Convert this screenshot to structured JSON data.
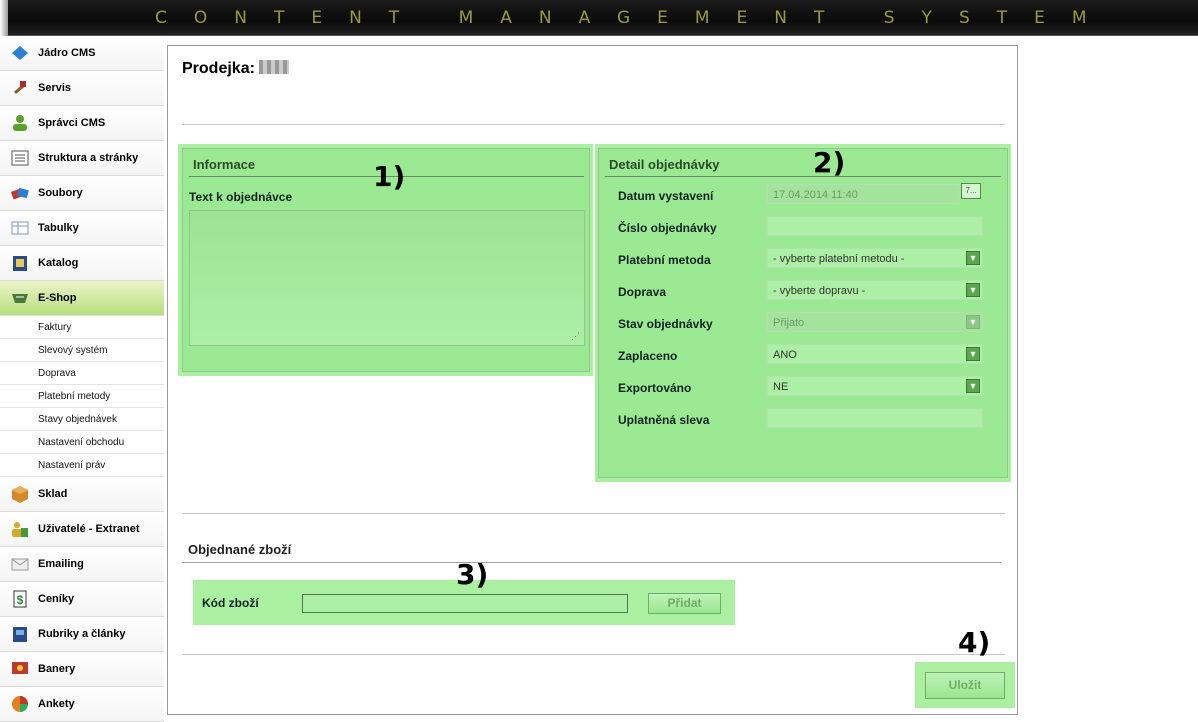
{
  "header": {
    "title": "CONTENT MANAGEMENT SYSTEM"
  },
  "sidebar": {
    "items_top": [
      {
        "label": "Jádro CMS",
        "icon": "diamond-icon",
        "color": "#2b7fd4"
      },
      {
        "label": "Servis",
        "icon": "hammer-icon",
        "color": "#b02a2a"
      },
      {
        "label": "Správci CMS",
        "icon": "user-icon",
        "color": "#5aa02c"
      },
      {
        "label": "Struktura a stránky",
        "icon": "list-icon",
        "color": "#555555"
      },
      {
        "label": "Soubory",
        "icon": "files-icon",
        "color": "#c0392b"
      },
      {
        "label": "Tabulky",
        "icon": "table-icon",
        "color": "#7a9acb"
      },
      {
        "label": "Katalog",
        "icon": "book-icon",
        "color": "#2a4a8a"
      },
      {
        "label": "E-Shop",
        "icon": "cart-icon",
        "color": "#4a7a3a"
      }
    ],
    "sub_items": [
      "Faktury",
      "Slevový systém",
      "Doprava",
      "Platební metody",
      "Stavy objednávek",
      "Nastavení obchodu",
      "Nastavení práv"
    ],
    "items_bottom": [
      {
        "label": "Sklad",
        "icon": "box-icon",
        "color": "#d48a2a"
      },
      {
        "label": "Uživatelé - Extranet",
        "icon": "users-icon",
        "color": "#d4a82a"
      },
      {
        "label": "Emailing",
        "icon": "envelope-icon",
        "color": "#999999"
      },
      {
        "label": "Ceníky",
        "icon": "dollar-icon",
        "color": "#2a8a3a"
      },
      {
        "label": "Rubriky a články",
        "icon": "articles-icon",
        "color": "#2a4a8a"
      },
      {
        "label": "Banery",
        "icon": "banner-icon",
        "color": "#c0392b"
      },
      {
        "label": "Ankety",
        "icon": "pie-chart-icon",
        "color": "#e67e22"
      }
    ]
  },
  "main": {
    "title": "Prodejka:",
    "info_panel": {
      "heading": "Informace",
      "text_label": "Text k objednávce",
      "marker": "1)"
    },
    "detail_panel": {
      "heading": "Detail objednávky",
      "marker": "2)",
      "fields": [
        {
          "label": "Datum vystavení",
          "value": "17.04.2014 11:40",
          "type": "date"
        },
        {
          "label": "Číslo objednávky",
          "value": "",
          "type": "text"
        },
        {
          "label": "Platební metoda",
          "value": "- vyberte platební metodu -",
          "type": "select"
        },
        {
          "label": "Doprava",
          "value": "- vyberte dopravu -",
          "type": "select"
        },
        {
          "label": "Stav objednávky",
          "value": "Přijato",
          "type": "select-disabled"
        },
        {
          "label": "Zaplaceno",
          "value": "ANO",
          "type": "select"
        },
        {
          "label": "Exportováno",
          "value": "NE",
          "type": "select"
        },
        {
          "label": "Uplatněná sleva",
          "value": "",
          "type": "text"
        }
      ]
    },
    "ordered_goods": {
      "title": "Objednané zboží",
      "code_label": "Kód zboží",
      "add_button": "Přidat",
      "marker": "3)"
    },
    "save": {
      "label": "Uložit",
      "marker": "4)"
    }
  }
}
